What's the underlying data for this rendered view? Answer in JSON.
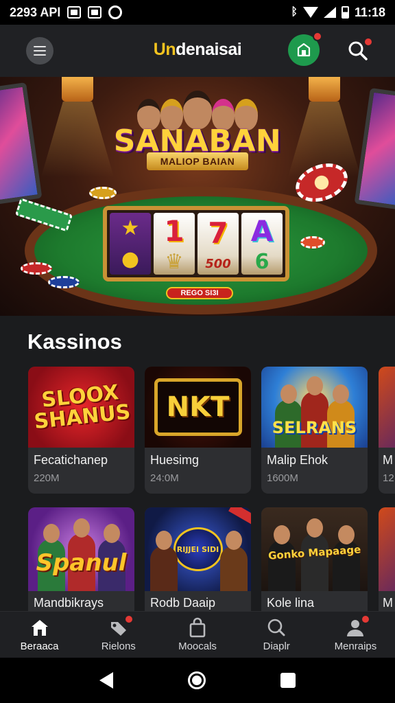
{
  "status_bar": {
    "left_text": "2293 APl",
    "time": "11:18"
  },
  "header": {
    "brand_prefix": "Un",
    "brand_rest": "denaisai",
    "menu_icon": "hamburger-icon",
    "store_icon": "store-icon",
    "search_icon": "search-icon",
    "accent_color": "#f2c31f",
    "store_color": "#1e9a4d",
    "badge_color": "#e53935"
  },
  "hero": {
    "title": "SANABAN",
    "subtitle": "MALIOP BAIAN",
    "reel_text": "500",
    "plate_text": "REGO SI3I"
  },
  "section": {
    "title": "Kassinos"
  },
  "games_row1": [
    {
      "art_text": "SLOOX SHANUS",
      "name": "Fecatichanep",
      "meta": "220M"
    },
    {
      "art_text": "NKT",
      "name": "Huesimg",
      "meta": "24:0M"
    },
    {
      "art_text": "SELRANS",
      "name": "Malip Ehok",
      "meta": "1600M"
    },
    {
      "art_text": "",
      "name": "M",
      "meta": "12"
    }
  ],
  "games_row2": [
    {
      "art_text": "Spanul",
      "name": "Mandbikrays",
      "meta": ""
    },
    {
      "art_text": "RIJJEI SIDI",
      "name": "Rodb Daaip",
      "meta": ""
    },
    {
      "art_text": "Gonko Mapaage",
      "name": "Kole lina",
      "meta": ""
    },
    {
      "art_text": "",
      "name": "M",
      "meta": ""
    }
  ],
  "bottom_nav": [
    {
      "label": "Beraaca",
      "icon": "home-icon"
    },
    {
      "label": "Rielons",
      "icon": "tag-icon"
    },
    {
      "label": "Moocals",
      "icon": "shopping-bag-icon"
    },
    {
      "label": "Diaplr",
      "icon": "search-icon"
    },
    {
      "label": "Menraips",
      "icon": "profile-icon"
    }
  ]
}
